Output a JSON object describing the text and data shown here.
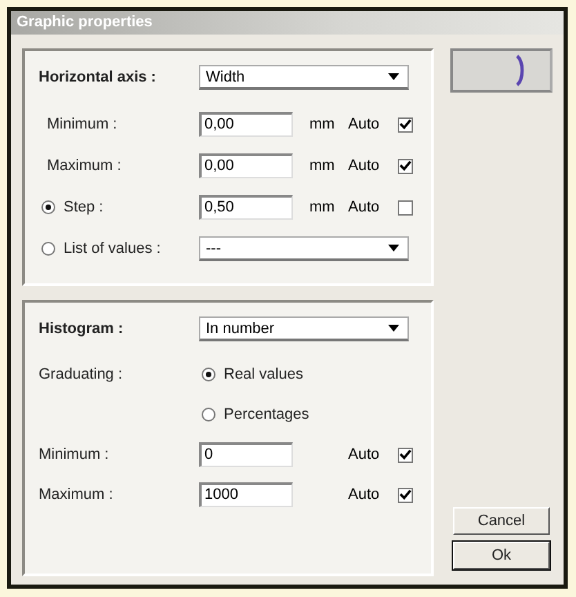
{
  "window": {
    "title": "Graphic properties"
  },
  "axis_panel": {
    "label": "Horizontal axis :",
    "value": "Width",
    "rows": [
      {
        "kind": "plain",
        "label": "Minimum :",
        "value": "0,00",
        "unit": "mm",
        "auto_label": "Auto",
        "auto_checked": true
      },
      {
        "kind": "plain",
        "label": "Maximum :",
        "value": "0,00",
        "unit": "mm",
        "auto_label": "Auto",
        "auto_checked": true
      },
      {
        "kind": "radio",
        "selected": true,
        "label": "Step :",
        "value": "0,50",
        "unit": "mm",
        "auto_label": "Auto",
        "auto_checked": false
      }
    ],
    "list": {
      "label": "List of values :",
      "selected": false,
      "value": "---"
    }
  },
  "histogram_panel": {
    "label": "Histogram :",
    "value": "In number",
    "graduating_label": "Graduating :",
    "options": [
      {
        "label": "Real values",
        "selected": true
      },
      {
        "label": "Percentages",
        "selected": false
      }
    ],
    "rows": [
      {
        "label": "Minimum :",
        "value": "0",
        "auto_label": "Auto",
        "auto_checked": true
      },
      {
        "label": "Maximum :",
        "value": "1000",
        "auto_label": "Auto",
        "auto_checked": true
      }
    ]
  },
  "buttons": [
    "Cancel",
    "Ok"
  ]
}
